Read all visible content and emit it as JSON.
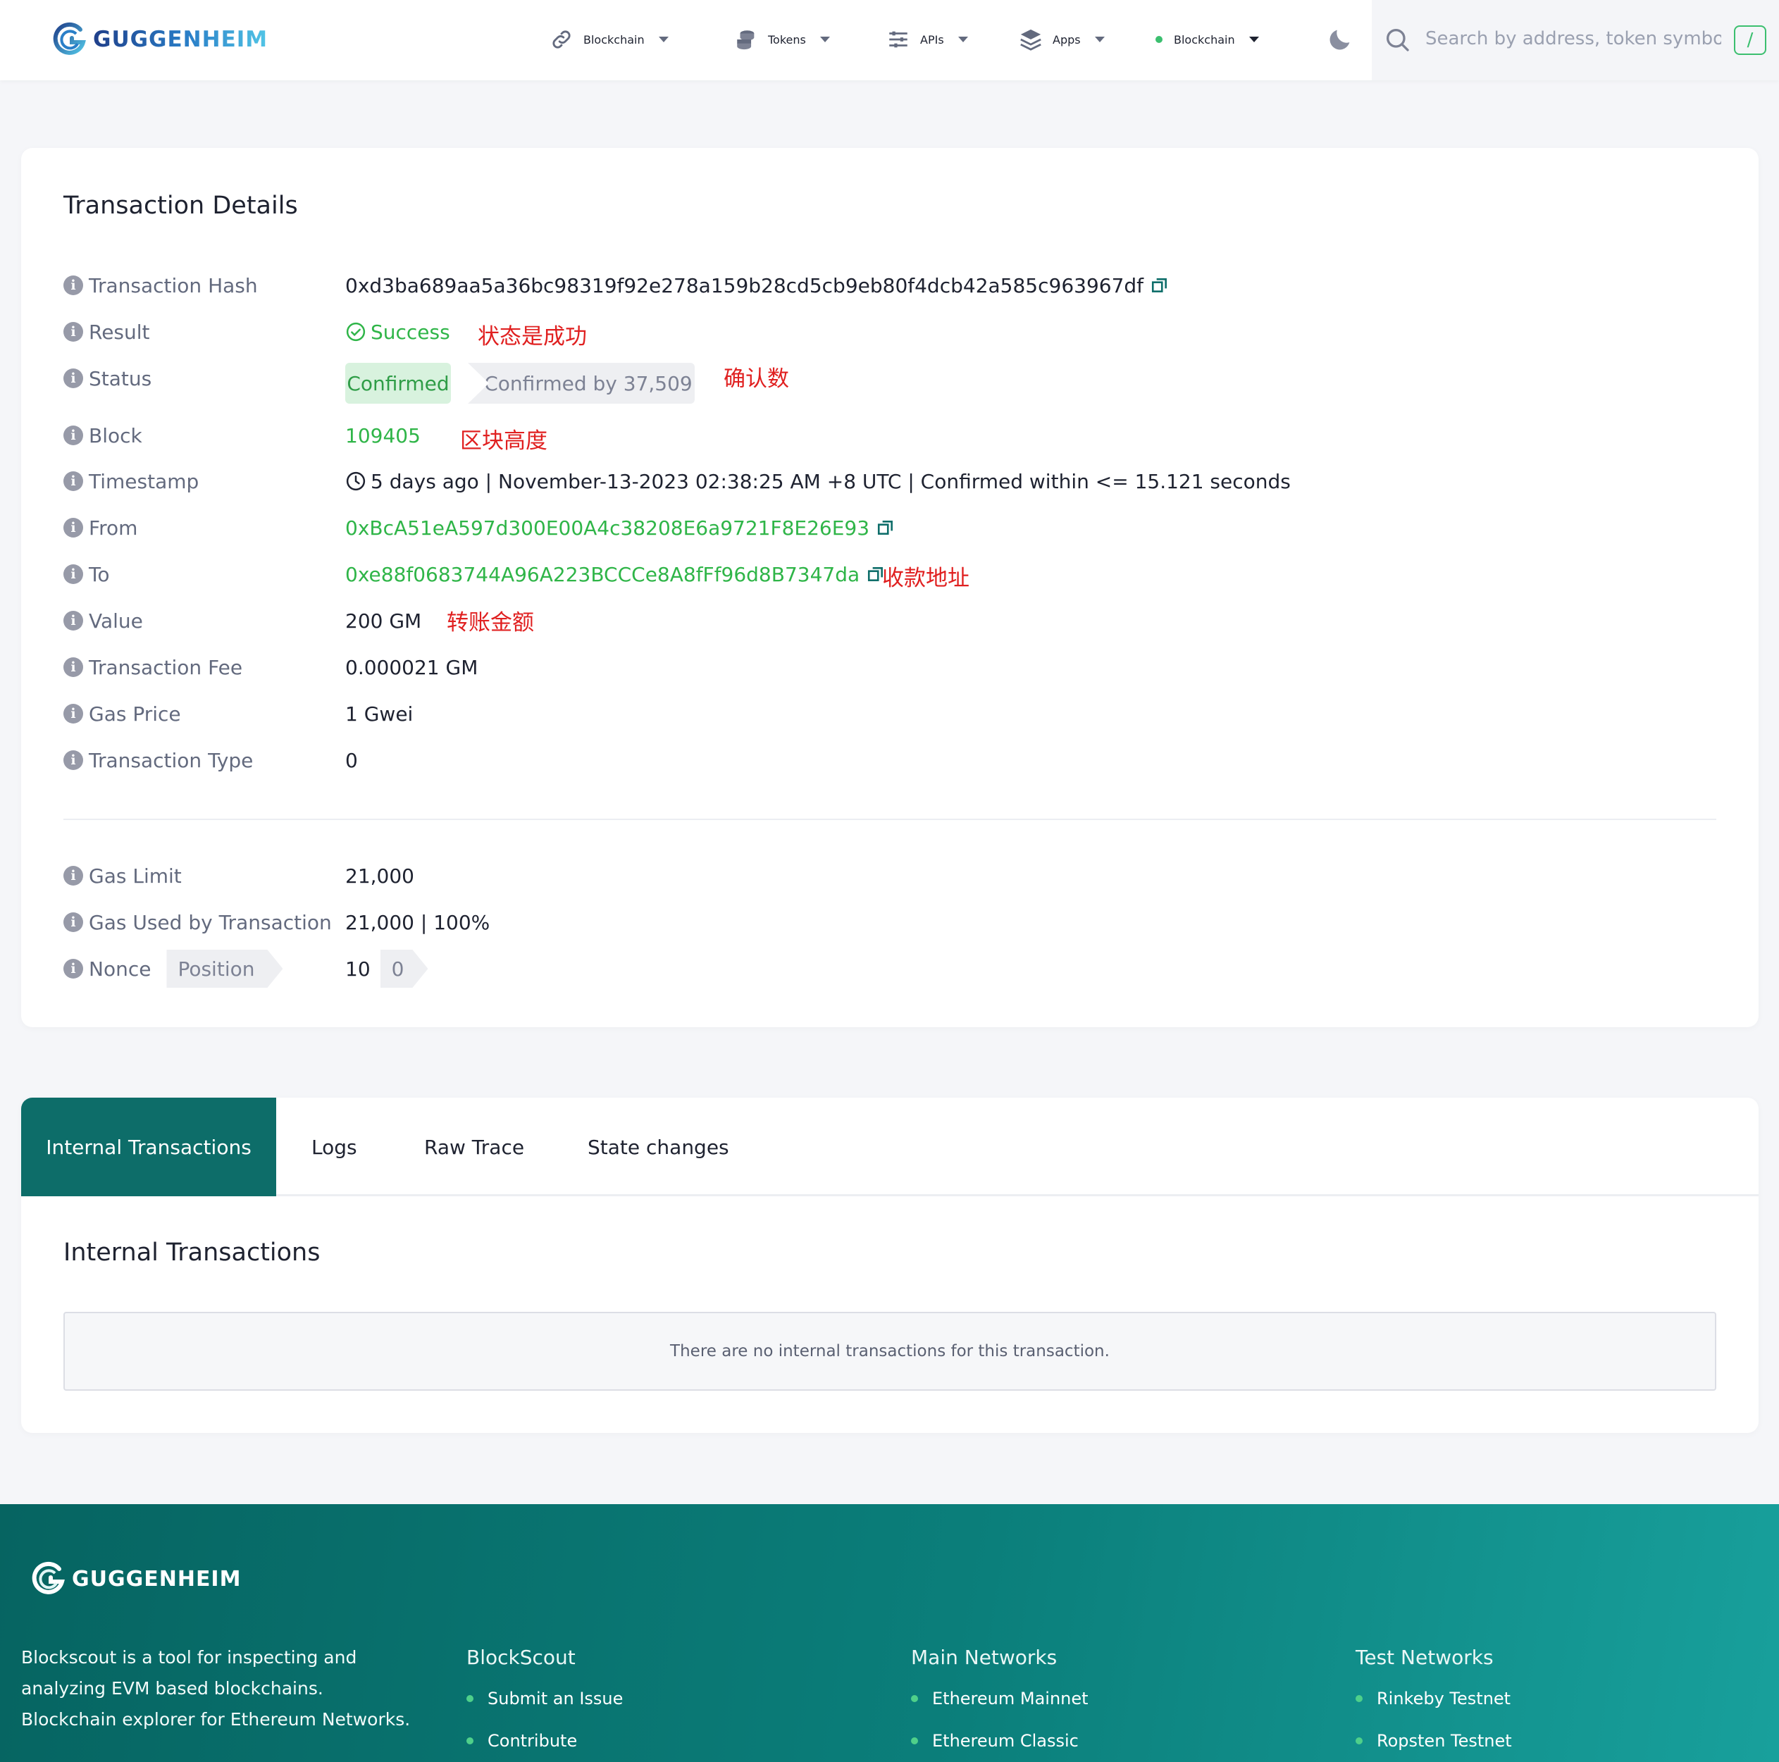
{
  "header": {
    "logo_text": "GUGGENHEIM",
    "nav": [
      {
        "label": "Blockchain",
        "icon": "link-icon"
      },
      {
        "label": "Tokens",
        "icon": "coins-icon"
      },
      {
        "label": "APIs",
        "icon": "sliders-icon"
      },
      {
        "label": "Apps",
        "icon": "layers-icon"
      },
      {
        "label": "Blockchain",
        "icon": "status-dot"
      }
    ],
    "search_placeholder": "Search by address, token symbol, name, transaction hash, or block number",
    "search_shortcut": "/"
  },
  "transaction": {
    "title": "Transaction Details",
    "rows": {
      "hash": {
        "label": "Transaction Hash",
        "value": "0xd3ba689aa5a36bc98319f92e278a159b28cd5cb9eb80f4dcb42a585c963967df"
      },
      "result": {
        "label": "Result",
        "value": "Success"
      },
      "status": {
        "label": "Status",
        "badge": "Confirmed",
        "confirmations": "Confirmed by 37,509"
      },
      "block": {
        "label": "Block",
        "value": "109405"
      },
      "timestamp": {
        "label": "Timestamp",
        "value": "5 days ago | November-13-2023 02:38:25 AM +8 UTC | Confirmed within <= 15.121 seconds"
      },
      "from": {
        "label": "From",
        "value": "0xBcA51eA597d300E00A4c38208E6a9721F8E26E93"
      },
      "to": {
        "label": "To",
        "value": "0xe88f0683744A96A223BCCCe8A8fFf96d8B7347da"
      },
      "value": {
        "label": "Value",
        "value": "200 GM"
      },
      "fee": {
        "label": "Transaction Fee",
        "value": "0.000021 GM"
      },
      "gas_price": {
        "label": "Gas Price",
        "value": "1 Gwei"
      },
      "tx_type": {
        "label": "Transaction Type",
        "value": "0"
      },
      "gas_limit": {
        "label": "Gas Limit",
        "value": "21,000"
      },
      "gas_used": {
        "label": "Gas Used by Transaction",
        "value": "21,000 | 100%"
      },
      "nonce": {
        "label": "Nonce",
        "position_label": "Position",
        "value": "10",
        "position": "0"
      }
    },
    "annotations": {
      "result": "状态是成功",
      "status": "确认数",
      "block": "区块高度",
      "to": "收款地址",
      "value": "转账金额"
    }
  },
  "tabs": {
    "items": [
      "Internal Transactions",
      "Logs",
      "Raw Trace",
      "State changes"
    ],
    "active": "Internal Transactions",
    "section_title": "Internal Transactions",
    "empty_message": "There are no internal transactions for this transaction."
  },
  "footer": {
    "logo_text": "GUGGENHEIM",
    "description": "Blockscout is a tool for inspecting and analyzing EVM based blockchains. Blockchain explorer for Ethereum Networks.",
    "columns": [
      {
        "title": "BlockScout",
        "links": [
          "Submit an Issue",
          "Contribute"
        ]
      },
      {
        "title": "Main Networks",
        "links": [
          "Ethereum Mainnet",
          "Ethereum Classic"
        ]
      },
      {
        "title": "Test Networks",
        "links": [
          "Rinkeby Testnet",
          "Ropsten Testnet"
        ]
      }
    ]
  },
  "colors": {
    "accent_green": "#2fb548",
    "tab_active": "#0d6d69",
    "annotation_red": "#e02020",
    "footer_gradient_start": "#066461",
    "footer_gradient_end": "#18a09c"
  }
}
